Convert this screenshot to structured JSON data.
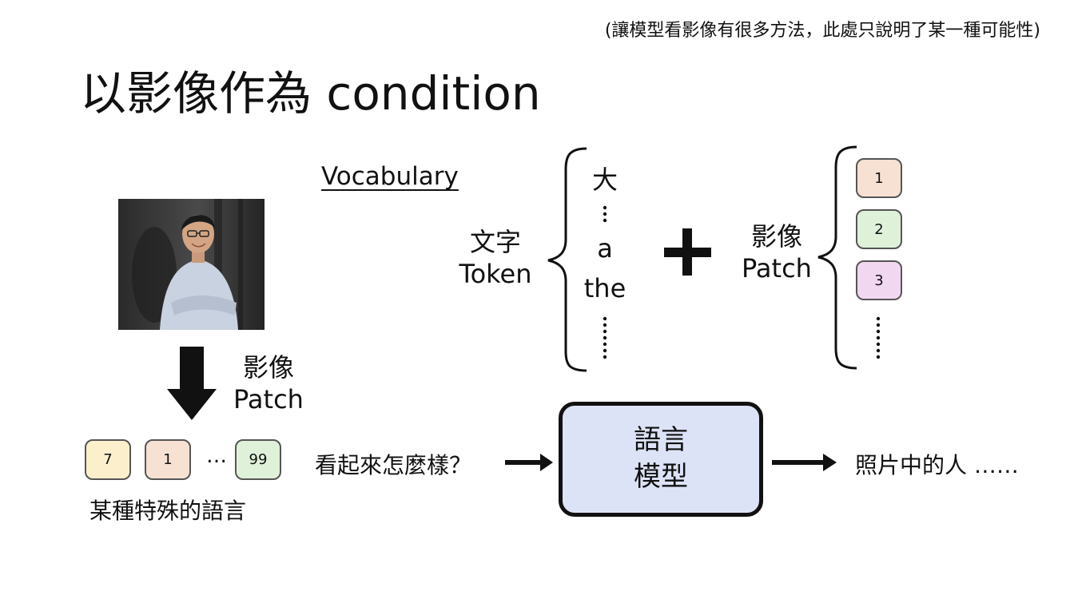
{
  "note": "(讓模型看影像有很多方法，此處只說明了某一種可能性)",
  "title": "以影像作為 condition",
  "vocabulary": {
    "label": "Vocabulary",
    "text_token": {
      "line1": "文字",
      "line2": "Token",
      "words": [
        "大",
        "a",
        "the"
      ]
    },
    "image_patch": {
      "line1": "影像",
      "line2": "Patch",
      "patches": [
        {
          "label": "1",
          "color": "#f7e1d2"
        },
        {
          "label": "2",
          "color": "#dff1d9"
        },
        {
          "label": "3",
          "color": "#f2d7f1"
        }
      ]
    }
  },
  "image_to_patch": {
    "line1": "影像",
    "line2": "Patch",
    "sequence": [
      {
        "label": "7",
        "color": "#fbefcc"
      },
      {
        "label": "1",
        "color": "#f7e1d2"
      },
      {
        "label": "99",
        "color": "#dff1d9"
      }
    ],
    "ellipsis": "…",
    "caption": "某種特殊的語言"
  },
  "prompt": "看起來怎麼樣？",
  "language_model": {
    "line1": "語言",
    "line2": "模型",
    "fill_color": "#dde3f7"
  },
  "output": "照片中的人 ……"
}
